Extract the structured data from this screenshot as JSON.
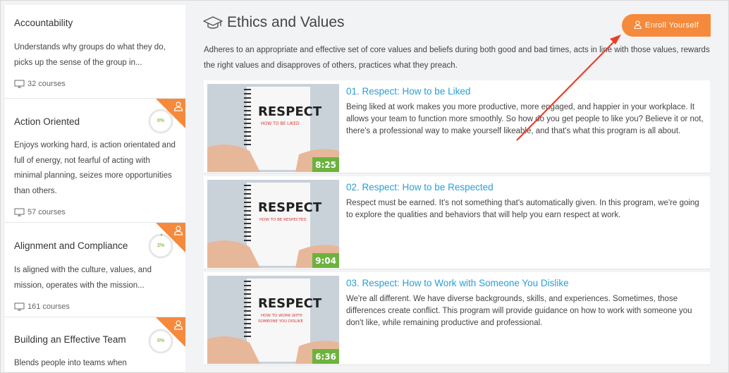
{
  "sidebar": {
    "items": [
      {
        "title": "Accountability",
        "desc": "Understands why groups do what they do, picks up the sense of the group in...",
        "count": "32 courses",
        "progress": null
      },
      {
        "title": "Action Oriented",
        "desc": "Enjoys working hard, is action orientated and full of energy, not fearful of acting with minimal planning, seizes more opportunities than others.",
        "count": "57 courses",
        "progress": "0%"
      },
      {
        "title": "Alignment and Compliance",
        "desc": "Is aligned with the culture, values, and mission, operates with the mission...",
        "count": "161 courses",
        "progress": "2%"
      },
      {
        "title": "Building an Effective Team",
        "desc": "Blends people into teams when",
        "count": "",
        "progress": "0%"
      }
    ]
  },
  "main": {
    "title": "Ethics and Values",
    "enroll_label": "Enroll Yourself",
    "description": "Adheres to an appropriate and effective set of core values and beliefs during both good and bad times, acts in line with those values, rewards the right values and disapproves of others, practices what they preach.",
    "courses": [
      {
        "title": "01. Respect: How to be Liked",
        "desc": "Being liked at work makes you more productive, more engaged, and happier in your workplace. It allows your team to function more smoothly. So how do you get people to like you? Believe it or not, there's a professional way to make yourself likeable, and that's what this program is all about.",
        "duration": "8:25",
        "thumb_title": "RESPECT",
        "thumb_sub1": "HOW TO BE LIKED",
        "thumb_sub2": ""
      },
      {
        "title": "02. Respect: How to be Respected",
        "desc": "Respect must be earned. It's not something that's automatically given. In this program, we're going to explore the qualities and behaviors that will help you earn respect at work.",
        "duration": "9:04",
        "thumb_title": "RESPECT",
        "thumb_sub1": "HOW TO BE RESPECTED",
        "thumb_sub2": ""
      },
      {
        "title": "03. Respect: How to Work with Someone You Dislike",
        "desc": "We're all different. We have diverse backgrounds, skills, and experiences. Sometimes, those differences create conflict. This program will provide guidance on how to work with someone you don't like, while remaining productive and professional.",
        "duration": "6:36",
        "thumb_title": "RESPECT",
        "thumb_sub1": "HOW TO WORK WITH",
        "thumb_sub2": "SOMEONE YOU DISLIKE"
      }
    ]
  },
  "colors": {
    "accent": "#f58a3c",
    "link": "#2a9fd6",
    "progress": "#8bc34a",
    "duration_bg": "#6cb33e",
    "arrow": "#e8402a"
  },
  "icons": {
    "title_icon": "graduation-cap-icon",
    "enroll_icon": "user-icon",
    "count_icon": "monitor-icon",
    "ribbon_icon": "user-icon"
  }
}
